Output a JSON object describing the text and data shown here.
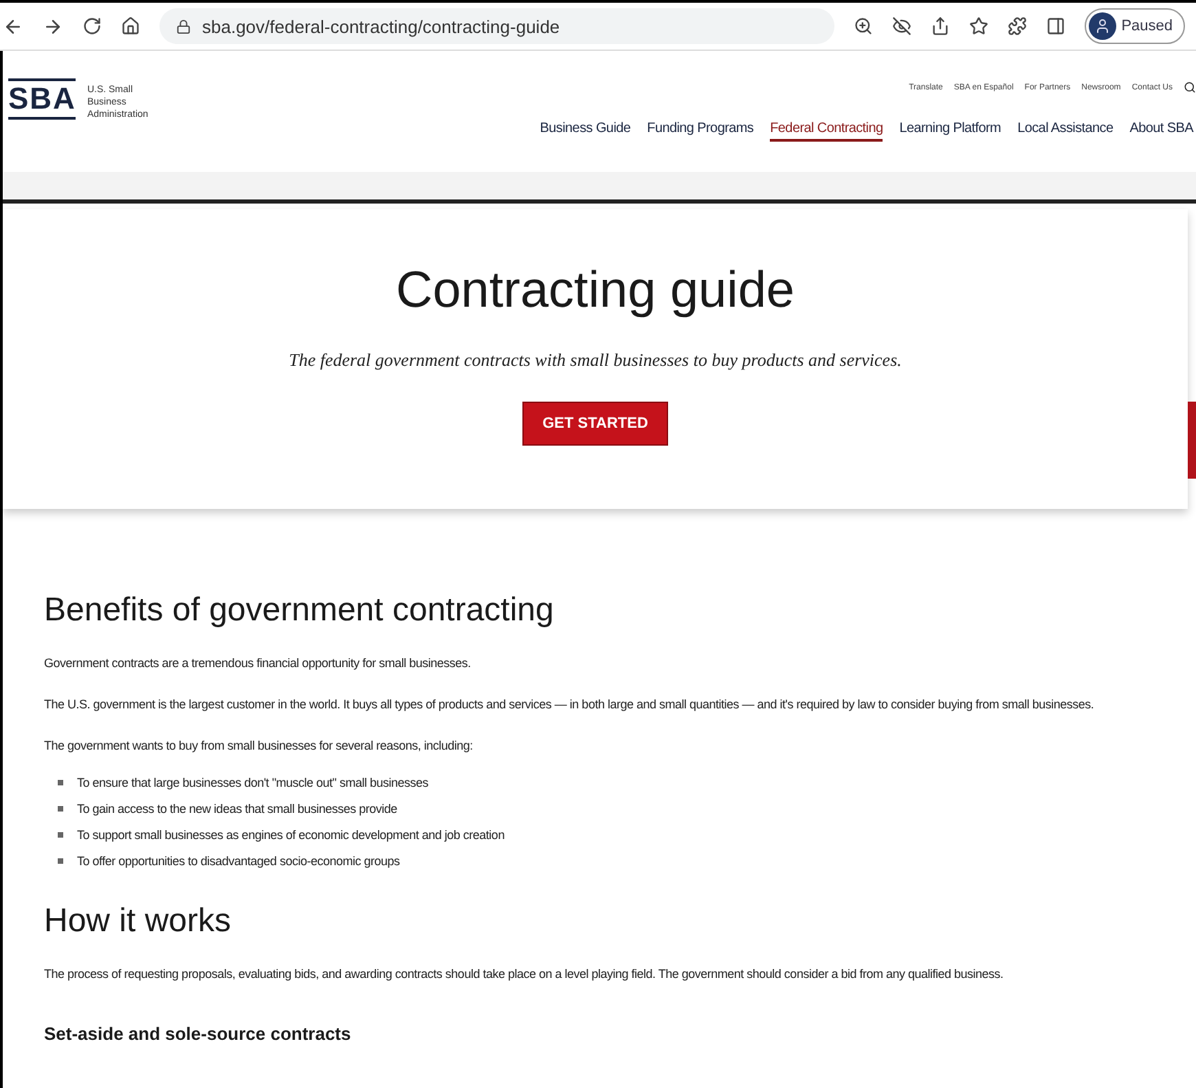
{
  "browser": {
    "url": "sba.gov/federal-contracting/contracting-guide",
    "profile_status": "Paused"
  },
  "header": {
    "logo": "SBA",
    "org_name": "U.S. Small Business Administration",
    "utility_links": [
      "Translate",
      "SBA en Español",
      "For Partners",
      "Newsroom",
      "Contact Us"
    ],
    "nav": [
      {
        "label": "Business Guide",
        "selected": false
      },
      {
        "label": "Funding Programs",
        "selected": false
      },
      {
        "label": "Federal Contracting",
        "selected": true
      },
      {
        "label": "Learning Platform",
        "selected": false
      },
      {
        "label": "Local Assistance",
        "selected": false
      },
      {
        "label": "About SBA",
        "selected": false
      }
    ]
  },
  "hero": {
    "title": "Contracting guide",
    "subtitle": "The federal government contracts with small businesses to buy products and services.",
    "button": "GET STARTED"
  },
  "sections": [
    {
      "heading": "Benefits of government contracting",
      "kind": "heading",
      "paragraphs": [
        "Government contracts are a tremendous financial opportunity for small businesses.",
        "The U.S. government is the largest customer in the world. It buys all types of products and services — in both large and small quantities — and it's required by law to consider buying from small businesses.",
        "The government wants to buy from small businesses for several reasons, including:"
      ],
      "bullets": [
        "To ensure that large businesses don't \"muscle out\" small businesses",
        "To gain access to the new ideas that small businesses provide",
        "To support small businesses as engines of economic development and job creation",
        "To offer opportunities to disadvantaged socio-economic groups"
      ]
    },
    {
      "heading": "How it works",
      "kind": "heading",
      "paragraphs": [
        "The process of requesting proposals, evaluating bids, and awarding contracts should take place on a level playing field. The government should consider a bid from any qualified business."
      ]
    },
    {
      "heading": "Set-aside and sole-source contracts",
      "kind": "subheading"
    }
  ]
}
